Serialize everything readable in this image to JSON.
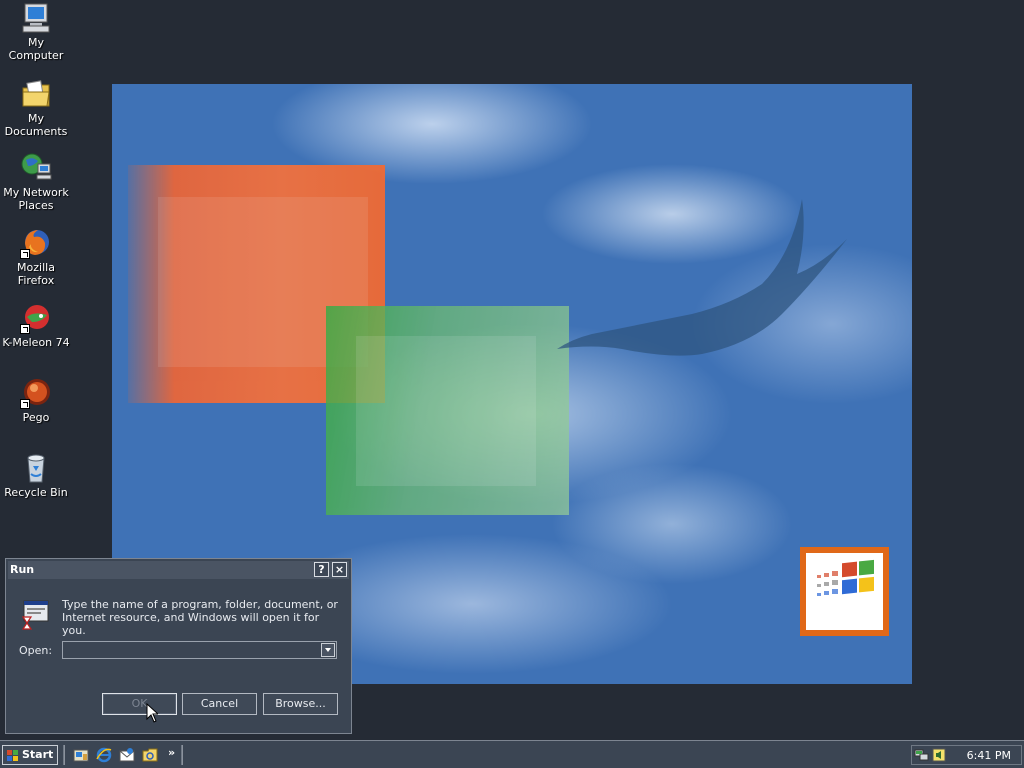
{
  "desktop": {
    "icons": [
      {
        "label": "My Computer",
        "icon": "my-computer-icon"
      },
      {
        "label": "My Documents",
        "icon": "my-documents-icon"
      },
      {
        "label": "My Network Places",
        "icon": "network-places-icon"
      },
      {
        "label": "Mozilla Firefox",
        "icon": "firefox-icon"
      },
      {
        "label": "K-Meleon 74",
        "icon": "k-meleon-icon"
      },
      {
        "label": "Pego",
        "icon": "pego-icon"
      },
      {
        "label": "Recycle Bin",
        "icon": "recycle-bin-icon"
      }
    ]
  },
  "run_dialog": {
    "title": "Run",
    "help_glyph": "?",
    "close_glyph": "×",
    "description": "Type the name of a program, folder, document, or Internet resource, and Windows will open it for you.",
    "open_label": "Open:",
    "open_value": "",
    "ok_label": "OK",
    "cancel_label": "Cancel",
    "browse_label": "Browse..."
  },
  "taskbar": {
    "start_label": "Start",
    "quick_launch_more": "»",
    "clock": "6:41 PM"
  },
  "colors": {
    "desktop_bg": "#252b35",
    "wallpaper_sky": "#3f72b6",
    "dialog_bg": "#3b4553",
    "windows_logo_frame": "#e06818"
  }
}
